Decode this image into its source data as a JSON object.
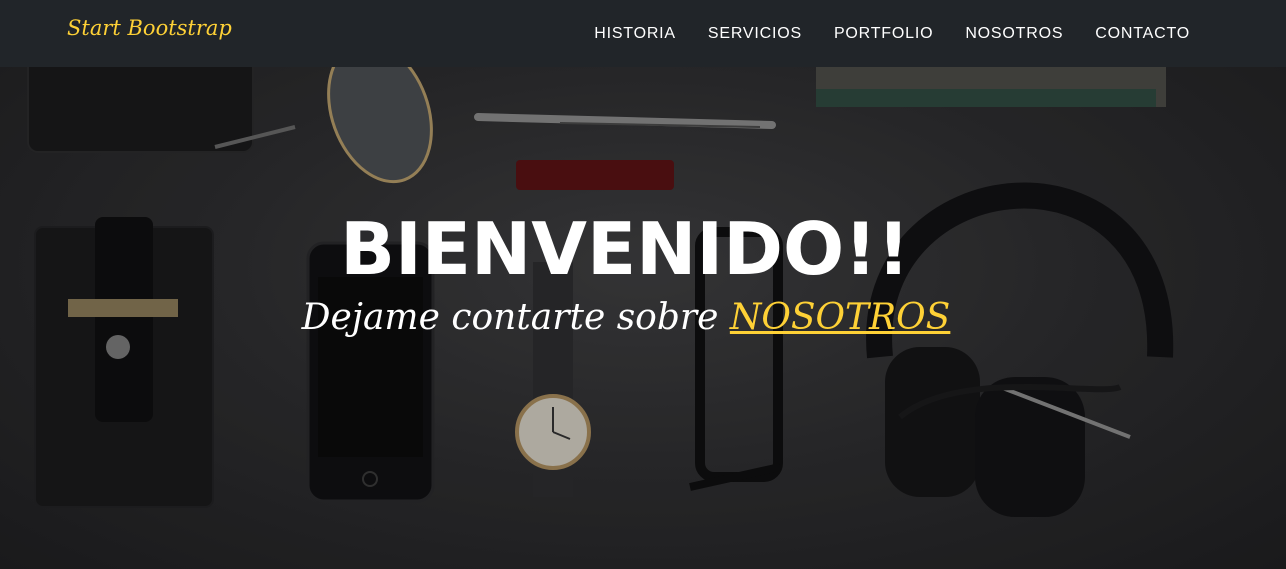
{
  "navbar": {
    "brand": "Start Bootstrap",
    "links": [
      "HISTORIA",
      "SERVICIOS",
      "PORTFOLIO",
      "NOSOTROS",
      "CONTACTO"
    ]
  },
  "hero": {
    "heading": "BIENVENIDO!!",
    "subheading_text": "Dejame contarte sobre",
    "subheading_link": "NOSOTROS"
  },
  "colors": {
    "navbar_bg": "#212529",
    "accent": "#fed136",
    "text": "#ffffff"
  }
}
